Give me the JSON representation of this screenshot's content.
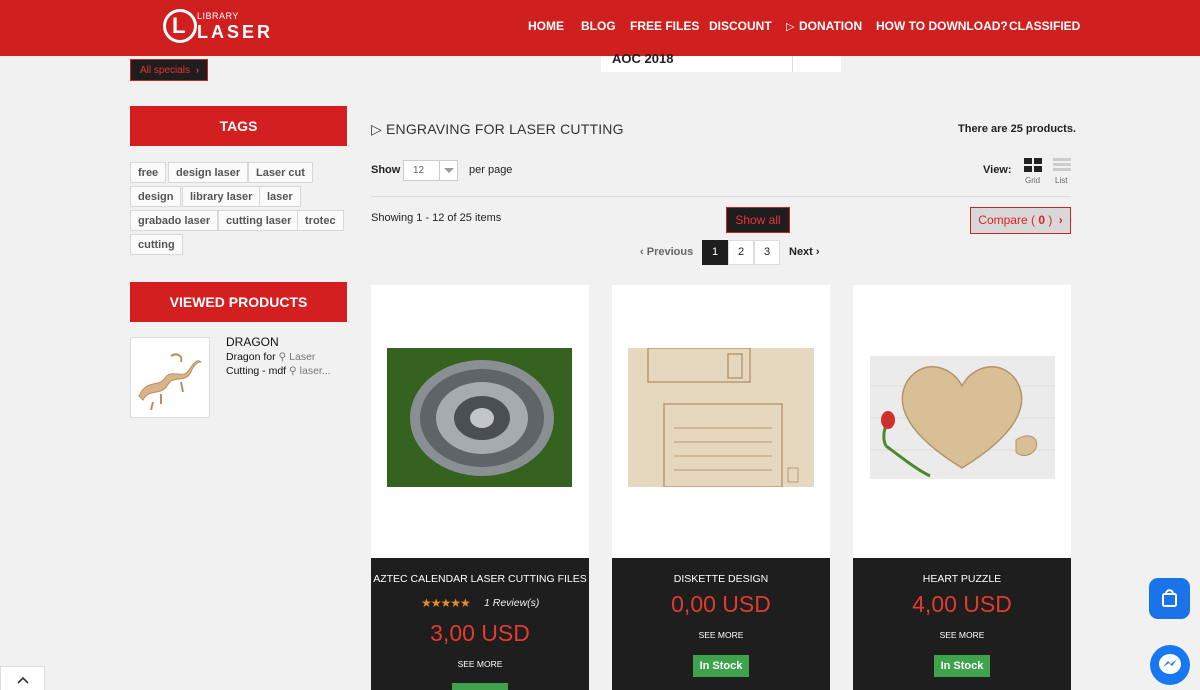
{
  "brand": {
    "logo_small": "LIBRARY",
    "logo_big": "LASER",
    "logo_letter": "L"
  },
  "nav": [
    {
      "label": "HOME"
    },
    {
      "label": "BLOG"
    },
    {
      "label": "FREE FILES"
    },
    {
      "label": "DISCOUNT"
    },
    {
      "label": "DONATION",
      "icon": "play-icon"
    },
    {
      "label": "HOW TO DOWNLOAD?"
    },
    {
      "label": "CLASSIFIED"
    }
  ],
  "specials": {
    "label": "All specials"
  },
  "aoc": {
    "label": "AOC 2018"
  },
  "tags": {
    "title": "TAGS",
    "items": [
      "free",
      "design laser",
      "Laser cut",
      "design",
      "library laser",
      "laser",
      "grabado laser",
      "cutting laser",
      "trotec",
      "cutting"
    ]
  },
  "viewed": {
    "title": "VIEWED PRODUCTS",
    "name": "DRAGON",
    "desc_1": "Dragon for",
    "desc_1b": "Laser",
    "desc_2": "Cutting - mdf",
    "desc_2b": "laser..."
  },
  "category": {
    "title": "ENGRAVING FOR LASER CUTTING",
    "count_text": "There are 25 products.",
    "show_label": "Show",
    "per_page_value": "12",
    "per_page_label": "per page",
    "view_label": "View:",
    "grid_label": "Grid",
    "list_label": "List",
    "showing_text": "Showing 1 - 12 of 25 items",
    "show_all": "Show all",
    "compare_label": "Compare (",
    "compare_count": "0",
    "compare_end": ")"
  },
  "pagination": {
    "prev": "Previous",
    "next": "Next",
    "pages": [
      "1",
      "2",
      "3"
    ],
    "active": "1"
  },
  "products": [
    {
      "name": "AZTEC CALENDAR LASER CUTTING FILES",
      "stars": "★★★★★",
      "reviews": "1 Review(s)",
      "price": "3,00 USD",
      "see_more": "SEE MORE",
      "stock": ""
    },
    {
      "name": "DISKETTE DESIGN",
      "price": "0,00 USD",
      "see_more": "SEE MORE",
      "stock": "In Stock"
    },
    {
      "name": "HEART PUZZLE",
      "price": "4,00 USD",
      "see_more": "SEE MORE",
      "stock": "In Stock"
    }
  ],
  "colors": {
    "brand_red": "#cf1f1f",
    "dark": "#1e1e1e",
    "price_red": "#e23b2e",
    "stock_green": "#3fa34d",
    "rating_orange": "#e9892f"
  }
}
